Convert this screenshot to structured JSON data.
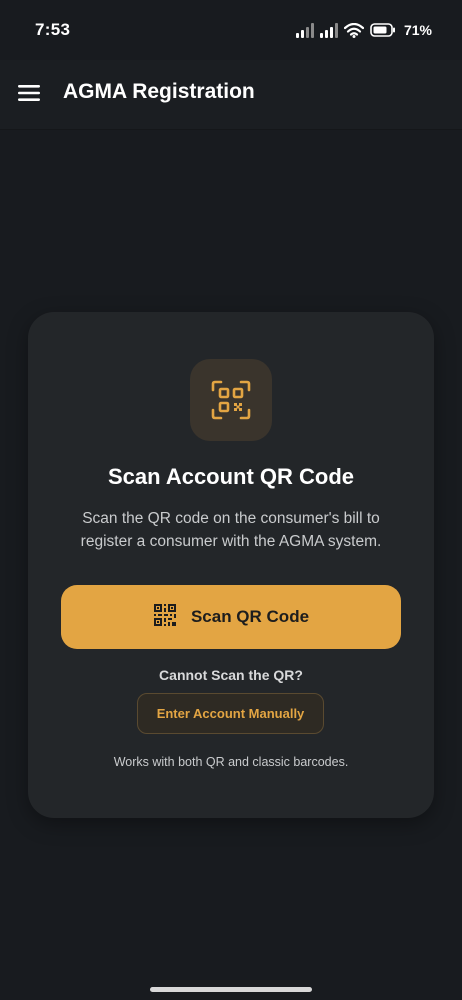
{
  "status_bar": {
    "time": "7:53",
    "battery": "71%",
    "icons": [
      "signal-icon",
      "signal-icon",
      "wifi-icon",
      "battery-icon"
    ]
  },
  "app_bar": {
    "menu_icon": "hamburger-menu-icon",
    "title": "AGMA Registration"
  },
  "card": {
    "icon": "qr-code-icon",
    "title": "Scan Account QR Code",
    "description": "Scan the QR code on the consumer's bill to register a consumer with the AGMA system.",
    "scan_button": {
      "icon": "qr-code-icon",
      "label": "Scan QR Code"
    },
    "cannot_scan": "Cannot Scan the QR?",
    "manual_button": {
      "label": "Enter Account Manually"
    },
    "note": "Works with both QR and classic barcodes."
  },
  "colors": {
    "background": "#181b1f",
    "card": "#232629",
    "accent": "#e3a543",
    "badge": "#3a342c"
  }
}
